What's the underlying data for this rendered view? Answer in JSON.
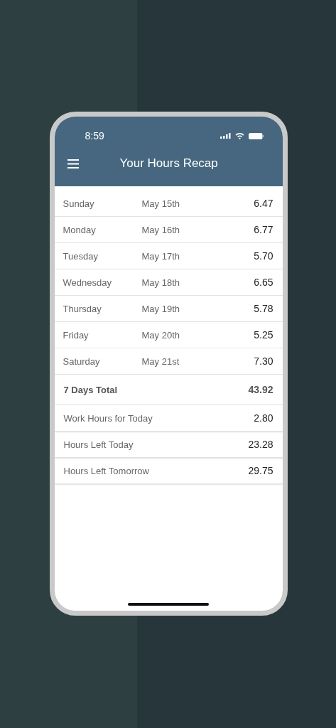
{
  "status_bar": {
    "time": "8:59"
  },
  "header": {
    "title": "Your Hours Recap"
  },
  "days": [
    {
      "day": "Sunday",
      "date": "May 15th",
      "hours": "6.47"
    },
    {
      "day": "Monday",
      "date": "May 16th",
      "hours": "6.77"
    },
    {
      "day": "Tuesday",
      "date": "May 17th",
      "hours": "5.70"
    },
    {
      "day": "Wednesday",
      "date": "May 18th",
      "hours": "6.65"
    },
    {
      "day": "Thursday",
      "date": "May 19th",
      "hours": "5.78"
    },
    {
      "day": "Friday",
      "date": "May 20th",
      "hours": "5.25"
    },
    {
      "day": "Saturday",
      "date": "May 21st",
      "hours": "7.30"
    }
  ],
  "total": {
    "label": "7 Days Total",
    "value": "43.92"
  },
  "summary": [
    {
      "label": "Work Hours for Today",
      "value": "2.80"
    },
    {
      "label": "Hours Left Today",
      "value": "23.28"
    },
    {
      "label": "Hours Left Tomorrow",
      "value": "29.75"
    }
  ]
}
